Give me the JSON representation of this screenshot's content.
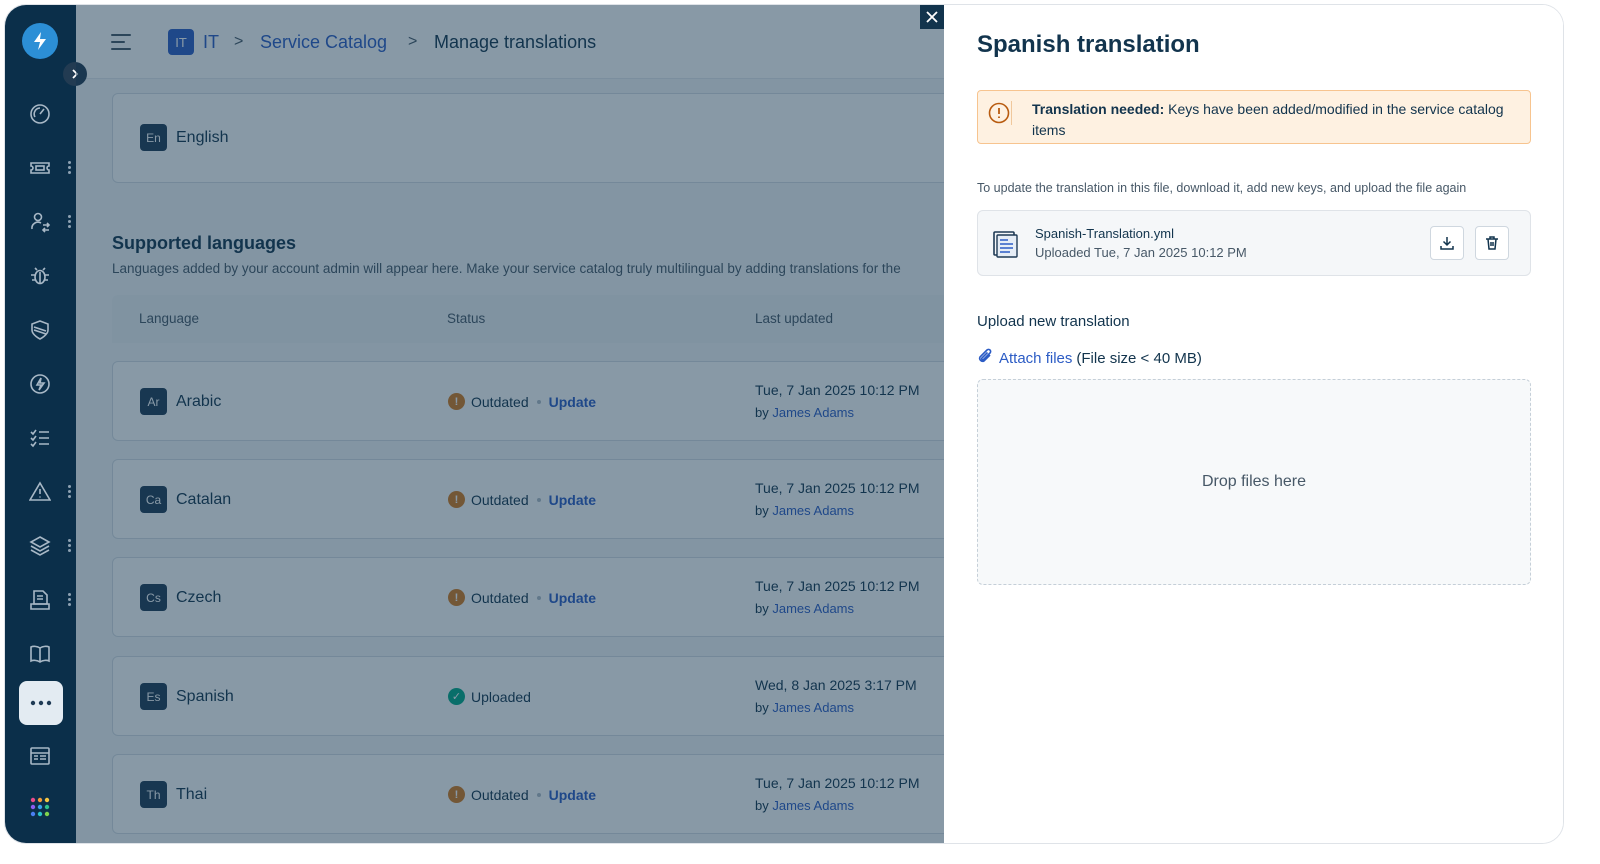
{
  "breadcrumb": {
    "workspace_badge": "IT",
    "workspace": "IT",
    "catalog": "Service Catalog",
    "current": "Manage translations",
    "separator": ">"
  },
  "primary_language": {
    "code": "En",
    "name": "English"
  },
  "supported": {
    "title": "Supported languages",
    "description": "Languages added by your account admin will appear here. Make your service catalog truly multilingual by adding translations for the"
  },
  "table": {
    "headers": {
      "language": "Language",
      "status": "Status",
      "last_updated": "Last updated"
    },
    "by_prefix": "by",
    "update_label": "Update",
    "rows": [
      {
        "code": "Ar",
        "name": "Arabic",
        "status": "Outdated",
        "status_type": "warning",
        "date": "Tue, 7 Jan 2025 10:12 PM",
        "user": "James Adams"
      },
      {
        "code": "Ca",
        "name": "Catalan",
        "status": "Outdated",
        "status_type": "warning",
        "date": "Tue, 7 Jan 2025 10:12 PM",
        "user": "James Adams"
      },
      {
        "code": "Cs",
        "name": "Czech",
        "status": "Outdated",
        "status_type": "warning",
        "date": "Tue, 7 Jan 2025 10:12 PM",
        "user": "James Adams"
      },
      {
        "code": "Es",
        "name": "Spanish",
        "status": "Uploaded",
        "status_type": "success",
        "date": "Wed, 8 Jan 2025 3:17 PM",
        "user": "James Adams"
      },
      {
        "code": "Th",
        "name": "Thai",
        "status": "Outdated",
        "status_type": "warning",
        "date": "Tue, 7 Jan 2025 10:12 PM",
        "user": "James Adams"
      }
    ]
  },
  "sidebar": {
    "icons": [
      "dashboard-icon",
      "tickets-icon",
      "changes-icon",
      "problems-icon",
      "security-icon",
      "releases-icon",
      "tasks-icon",
      "alerts-icon",
      "assets-icon",
      "reports-icon",
      "solutions-icon",
      "more-icon",
      "catalog-icon",
      "apps-icon"
    ]
  },
  "drawer": {
    "title": "Spanish translation",
    "alert": {
      "bold": "Translation needed:",
      "text": "Keys have been added/modified in the service catalog items"
    },
    "help_text": "To update the translation in this file, download it, add new keys, and upload the file again",
    "file": {
      "name": "Spanish-Translation.yml",
      "meta": "Uploaded Tue, 7 Jan 2025 10:12 PM"
    },
    "upload_title": "Upload new translation",
    "attach_label": "Attach files",
    "attach_size": "(File size < 40 MB)",
    "drop_text": "Drop files here"
  },
  "colors": {
    "sidebar": "#0b2f4a",
    "accent": "#2c5cc5",
    "warning": "#d57a1e",
    "success": "#00a886",
    "alert_bg": "#fef1e1"
  }
}
